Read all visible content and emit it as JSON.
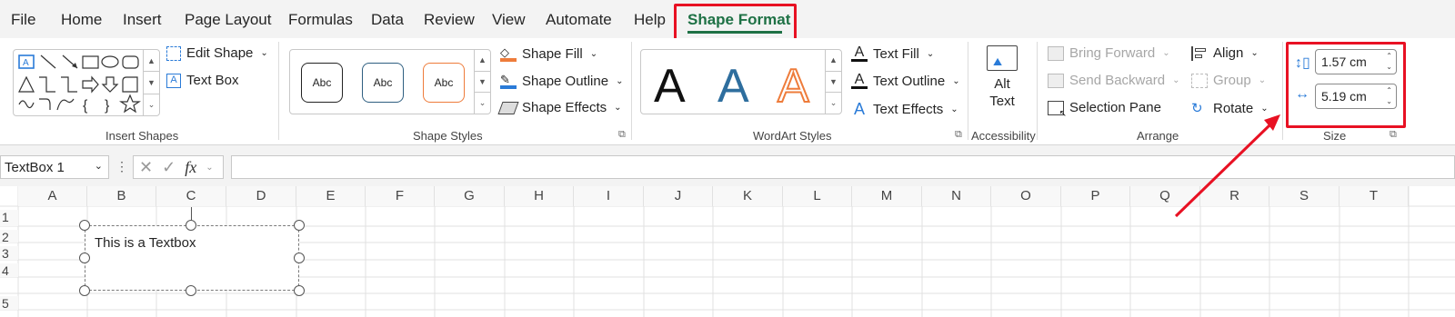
{
  "tabs": [
    "File",
    "Home",
    "Insert",
    "Page Layout",
    "Formulas",
    "Data",
    "Review",
    "View",
    "Automate",
    "Help",
    "Shape Format"
  ],
  "active_tab": "Shape Format",
  "ribbon": {
    "insert_shapes": {
      "edit_shape": "Edit Shape",
      "text_box": "Text Box",
      "label": "Insert Shapes"
    },
    "shape_styles": {
      "preview": [
        "Abc",
        "Abc",
        "Abc"
      ],
      "shape_fill": "Shape Fill",
      "shape_outline": "Shape Outline",
      "shape_effects": "Shape Effects",
      "label": "Shape Styles"
    },
    "wordart_styles": {
      "preview": [
        "A",
        "A",
        "A"
      ],
      "text_fill": "Text Fill",
      "text_outline": "Text Outline",
      "text_effects": "Text Effects",
      "label": "WordArt Styles"
    },
    "accessibility": {
      "alt_text_line1": "Alt",
      "alt_text_line2": "Text",
      "label": "Accessibility"
    },
    "arrange": {
      "bring_forward": "Bring Forward",
      "send_backward": "Send Backward",
      "selection_pane": "Selection Pane",
      "align": "Align",
      "group": "Group",
      "rotate": "Rotate",
      "label": "Arrange"
    },
    "size": {
      "height": "1.57 cm",
      "width": "5.19 cm",
      "label": "Size"
    }
  },
  "name_box": "TextBox 1",
  "fx_label": "fx",
  "columns": [
    "A",
    "B",
    "C",
    "D",
    "E",
    "F",
    "G",
    "H",
    "I",
    "J",
    "K",
    "L",
    "M",
    "N",
    "O",
    "P",
    "Q",
    "R",
    "S",
    "T"
  ],
  "rows": [
    "1",
    "2",
    "3",
    "4",
    "5"
  ],
  "textbox_text": "This is a Textbox",
  "colors": {
    "accent_green": "#1e7145",
    "highlight_red": "#e81123",
    "wordart_blue": "#2e6e9e",
    "wordart_orange": "#ee7c3b"
  }
}
